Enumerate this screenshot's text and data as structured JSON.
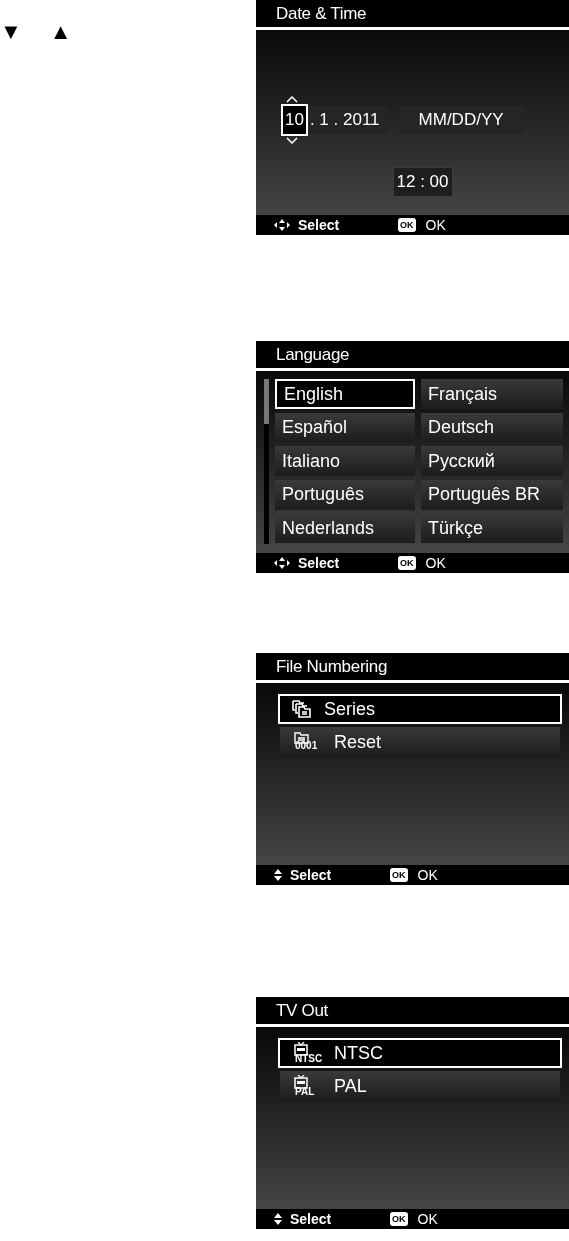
{
  "arrows": [
    "▼",
    "▲"
  ],
  "date_time": {
    "title": "Date & Time",
    "date_segments": [
      {
        "text": "10",
        "selected": true
      },
      {
        "text": ". 1 . 2011",
        "selected": false
      }
    ],
    "date_format": "MM/DD/YY",
    "time": "12 : 00",
    "footer": {
      "kind": "four-way",
      "nav": "Select",
      "ok_badge": "OK",
      "ok": "OK"
    }
  },
  "language": {
    "title": "Language",
    "options": [
      {
        "text": "English",
        "selected": true
      },
      {
        "text": "Français",
        "selected": false
      },
      {
        "text": "Español",
        "selected": false
      },
      {
        "text": "Deutsch",
        "selected": false
      },
      {
        "text": "Italiano",
        "selected": false
      },
      {
        "text": "Русский",
        "selected": false
      },
      {
        "text": "Português",
        "selected": false
      },
      {
        "text": "Português BR",
        "selected": false
      },
      {
        "text": "Nederlands",
        "selected": false
      },
      {
        "text": "Türkçe",
        "selected": false
      }
    ],
    "footer": {
      "kind": "four-way",
      "nav": "Select",
      "ok_badge": "OK",
      "ok": "OK"
    }
  },
  "file_numbering": {
    "title": "File Numbering",
    "items": [
      {
        "kind": "folders",
        "text": "Series",
        "selected": true
      },
      {
        "kind": "folder-number",
        "icon_label": "0001",
        "text": "Reset",
        "selected": false
      }
    ],
    "footer": {
      "kind": "up-down",
      "nav": "Select",
      "ok_badge": "OK",
      "ok": "OK"
    }
  },
  "tv_out": {
    "title": "TV Out",
    "items": [
      {
        "kind": "tv",
        "icon_label": "NTSC",
        "text": "NTSC",
        "selected": true
      },
      {
        "kind": "tv",
        "icon_label": "PAL",
        "text": "PAL",
        "selected": false
      }
    ],
    "footer": {
      "kind": "up-down",
      "nav": "Select",
      "ok_badge": "OK",
      "ok": "OK"
    }
  }
}
